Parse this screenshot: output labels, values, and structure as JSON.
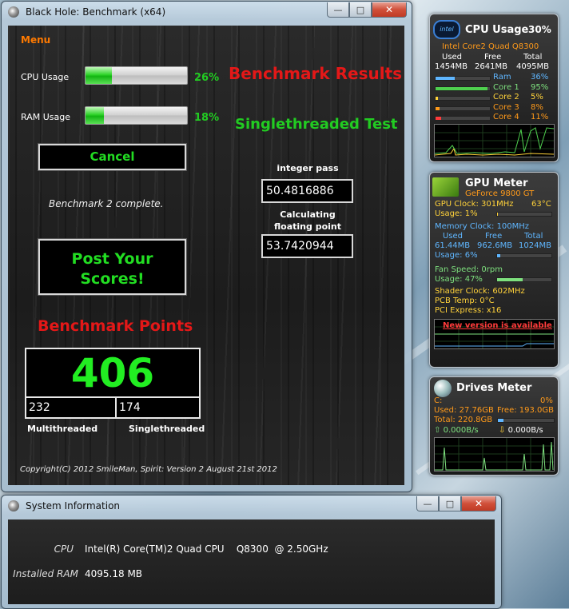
{
  "bench_window": {
    "title": "Black Hole: Benchmark (x64)",
    "menu": "Menu",
    "cpu_label": "CPU Usage",
    "cpu_percent": "26%",
    "cpu_fill": 0.26,
    "ram_label": "RAM Usage",
    "ram_percent": "18%",
    "ram_fill": 0.18,
    "cancel_label": "Cancel",
    "status": "Benchmark 2 complete.",
    "post_label_1": "Post Your",
    "post_label_2": "Scores!",
    "results_title": "Benchmark Results",
    "test_title": "Singlethreaded Test",
    "integer_caption": "integer pass",
    "integer_value": "50.4816886",
    "float_caption_1": "Calculating",
    "float_caption_2": "floating point",
    "float_value": "53.7420944",
    "points_title": "Benchmark Points",
    "total_score": "406",
    "multi_value": "232",
    "single_value": "174",
    "multi_label": "Multithreaded",
    "single_label": "Singlethreaded",
    "copyright": "Copyright(C) 2012 SmileMan, Spirit: Version 2 August 21st 2012"
  },
  "sysinfo_window": {
    "title": "System Information",
    "cpu_label": "CPU",
    "cpu_value": "Intel(R) Core(TM)2 Quad CPU    Q8300  @ 2.50GHz",
    "ram_label": "Installed RAM",
    "ram_value": "4095.18 MB"
  },
  "cpu_gadget": {
    "title": "CPU Usage",
    "percent": "30%",
    "badge": "intel",
    "processor": "Intel Core2 Quad Q8300",
    "h_used": "Used",
    "h_free": "Free",
    "h_total": "Total",
    "used": "1454MB",
    "free": "2641MB",
    "total": "4095MB",
    "rows": [
      {
        "label": "Ram",
        "value": "36%",
        "fill": 0.36,
        "color": "#5fb6ff",
        "lcolor": "#5fb6ff"
      },
      {
        "label": "Core 1",
        "value": "95%",
        "fill": 0.95,
        "color": "#4fd04f",
        "lcolor": "#7ee07e"
      },
      {
        "label": "Core 2",
        "value": "5%",
        "fill": 0.05,
        "color": "#ffd23a",
        "lcolor": "#ffd23a"
      },
      {
        "label": "Core 3",
        "value": "8%",
        "fill": 0.08,
        "color": "#ff9a1a",
        "lcolor": "#ff9a1a"
      },
      {
        "label": "Core 4",
        "value": "11%",
        "fill": 0.11,
        "color": "#ff3b3b",
        "lcolor": "#ff9a1a"
      }
    ]
  },
  "gpu_gadget": {
    "title": "GPU Meter",
    "model": "GeForce 9800 GT",
    "gpu_clock": "GPU Clock: 301MHz",
    "gpu_temp": "63°C",
    "gpu_usage": "Usage: 1%",
    "gpu_usage_fill": 0.01,
    "mem_clock": "Memory Clock: 100MHz",
    "h_used": "Used",
    "h_free": "Free",
    "h_total": "Total",
    "mem_used": "61.44MB",
    "mem_free": "962.6MB",
    "mem_total": "1024MB",
    "mem_usage": "Usage: 6%",
    "mem_usage_fill": 0.06,
    "fan_speed": "Fan Speed: 0rpm",
    "fan_usage": "Usage: 47%",
    "fan_usage_fill": 0.47,
    "shader_clock": "Shader Clock: 602MHz",
    "pcb_temp": "PCB Temp: 0°C",
    "pci_express": "PCI Express: x16",
    "new_version": "New version is available"
  },
  "drives_gadget": {
    "title": "Drives Meter",
    "drive": "C:",
    "percent": "0%",
    "used": "Used: 27.76GB",
    "free": "Free: 193.0GB",
    "total": "Total: 220.8GB",
    "read": "0.000B/s",
    "write": "0.000B/s"
  }
}
